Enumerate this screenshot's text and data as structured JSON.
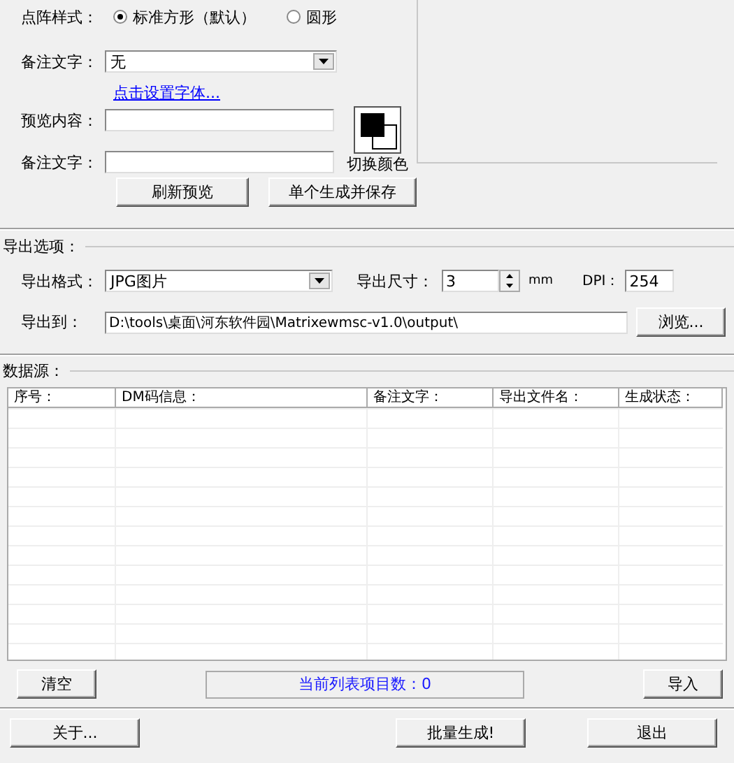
{
  "dot_style": {
    "label": "点阵样式：",
    "options": [
      {
        "label": "标准方形（默认）",
        "selected": true
      },
      {
        "label": "圆形",
        "selected": false
      }
    ]
  },
  "note_font": {
    "label": "备注文字：",
    "value": "无",
    "link": "点击设置字体..."
  },
  "preview_content": {
    "label": "预览内容："
  },
  "note_text": {
    "label": "备注文字："
  },
  "color_swap": {
    "label": "切换颜色"
  },
  "buttons": [
    "刷新预览",
    "单个生成并保存"
  ],
  "export": {
    "title": "导出选项：",
    "format_label": "导出格式：",
    "format": "JPG图片",
    "size_label": "导出尺寸：",
    "size": "3",
    "size_unit": "mm",
    "dpi_label": "DPI：",
    "dpi": "254",
    "path_label": "导出到：",
    "path": "D:\\tools\\桌面\\河东软件园\\Matrixewmsc-v1.0\\output\\",
    "browse": "浏览..."
  },
  "data_source": {
    "title": "数据源：",
    "columns": [
      "序号：",
      "DM码信息：",
      "备注文字：",
      "导出文件名：",
      "生成状态："
    ]
  },
  "status": {
    "clear": "清空",
    "count": "当前列表项目数：0",
    "import": "导入"
  },
  "footer": {
    "about": "关于...",
    "batch": "批量生成!",
    "exit": "退出"
  }
}
